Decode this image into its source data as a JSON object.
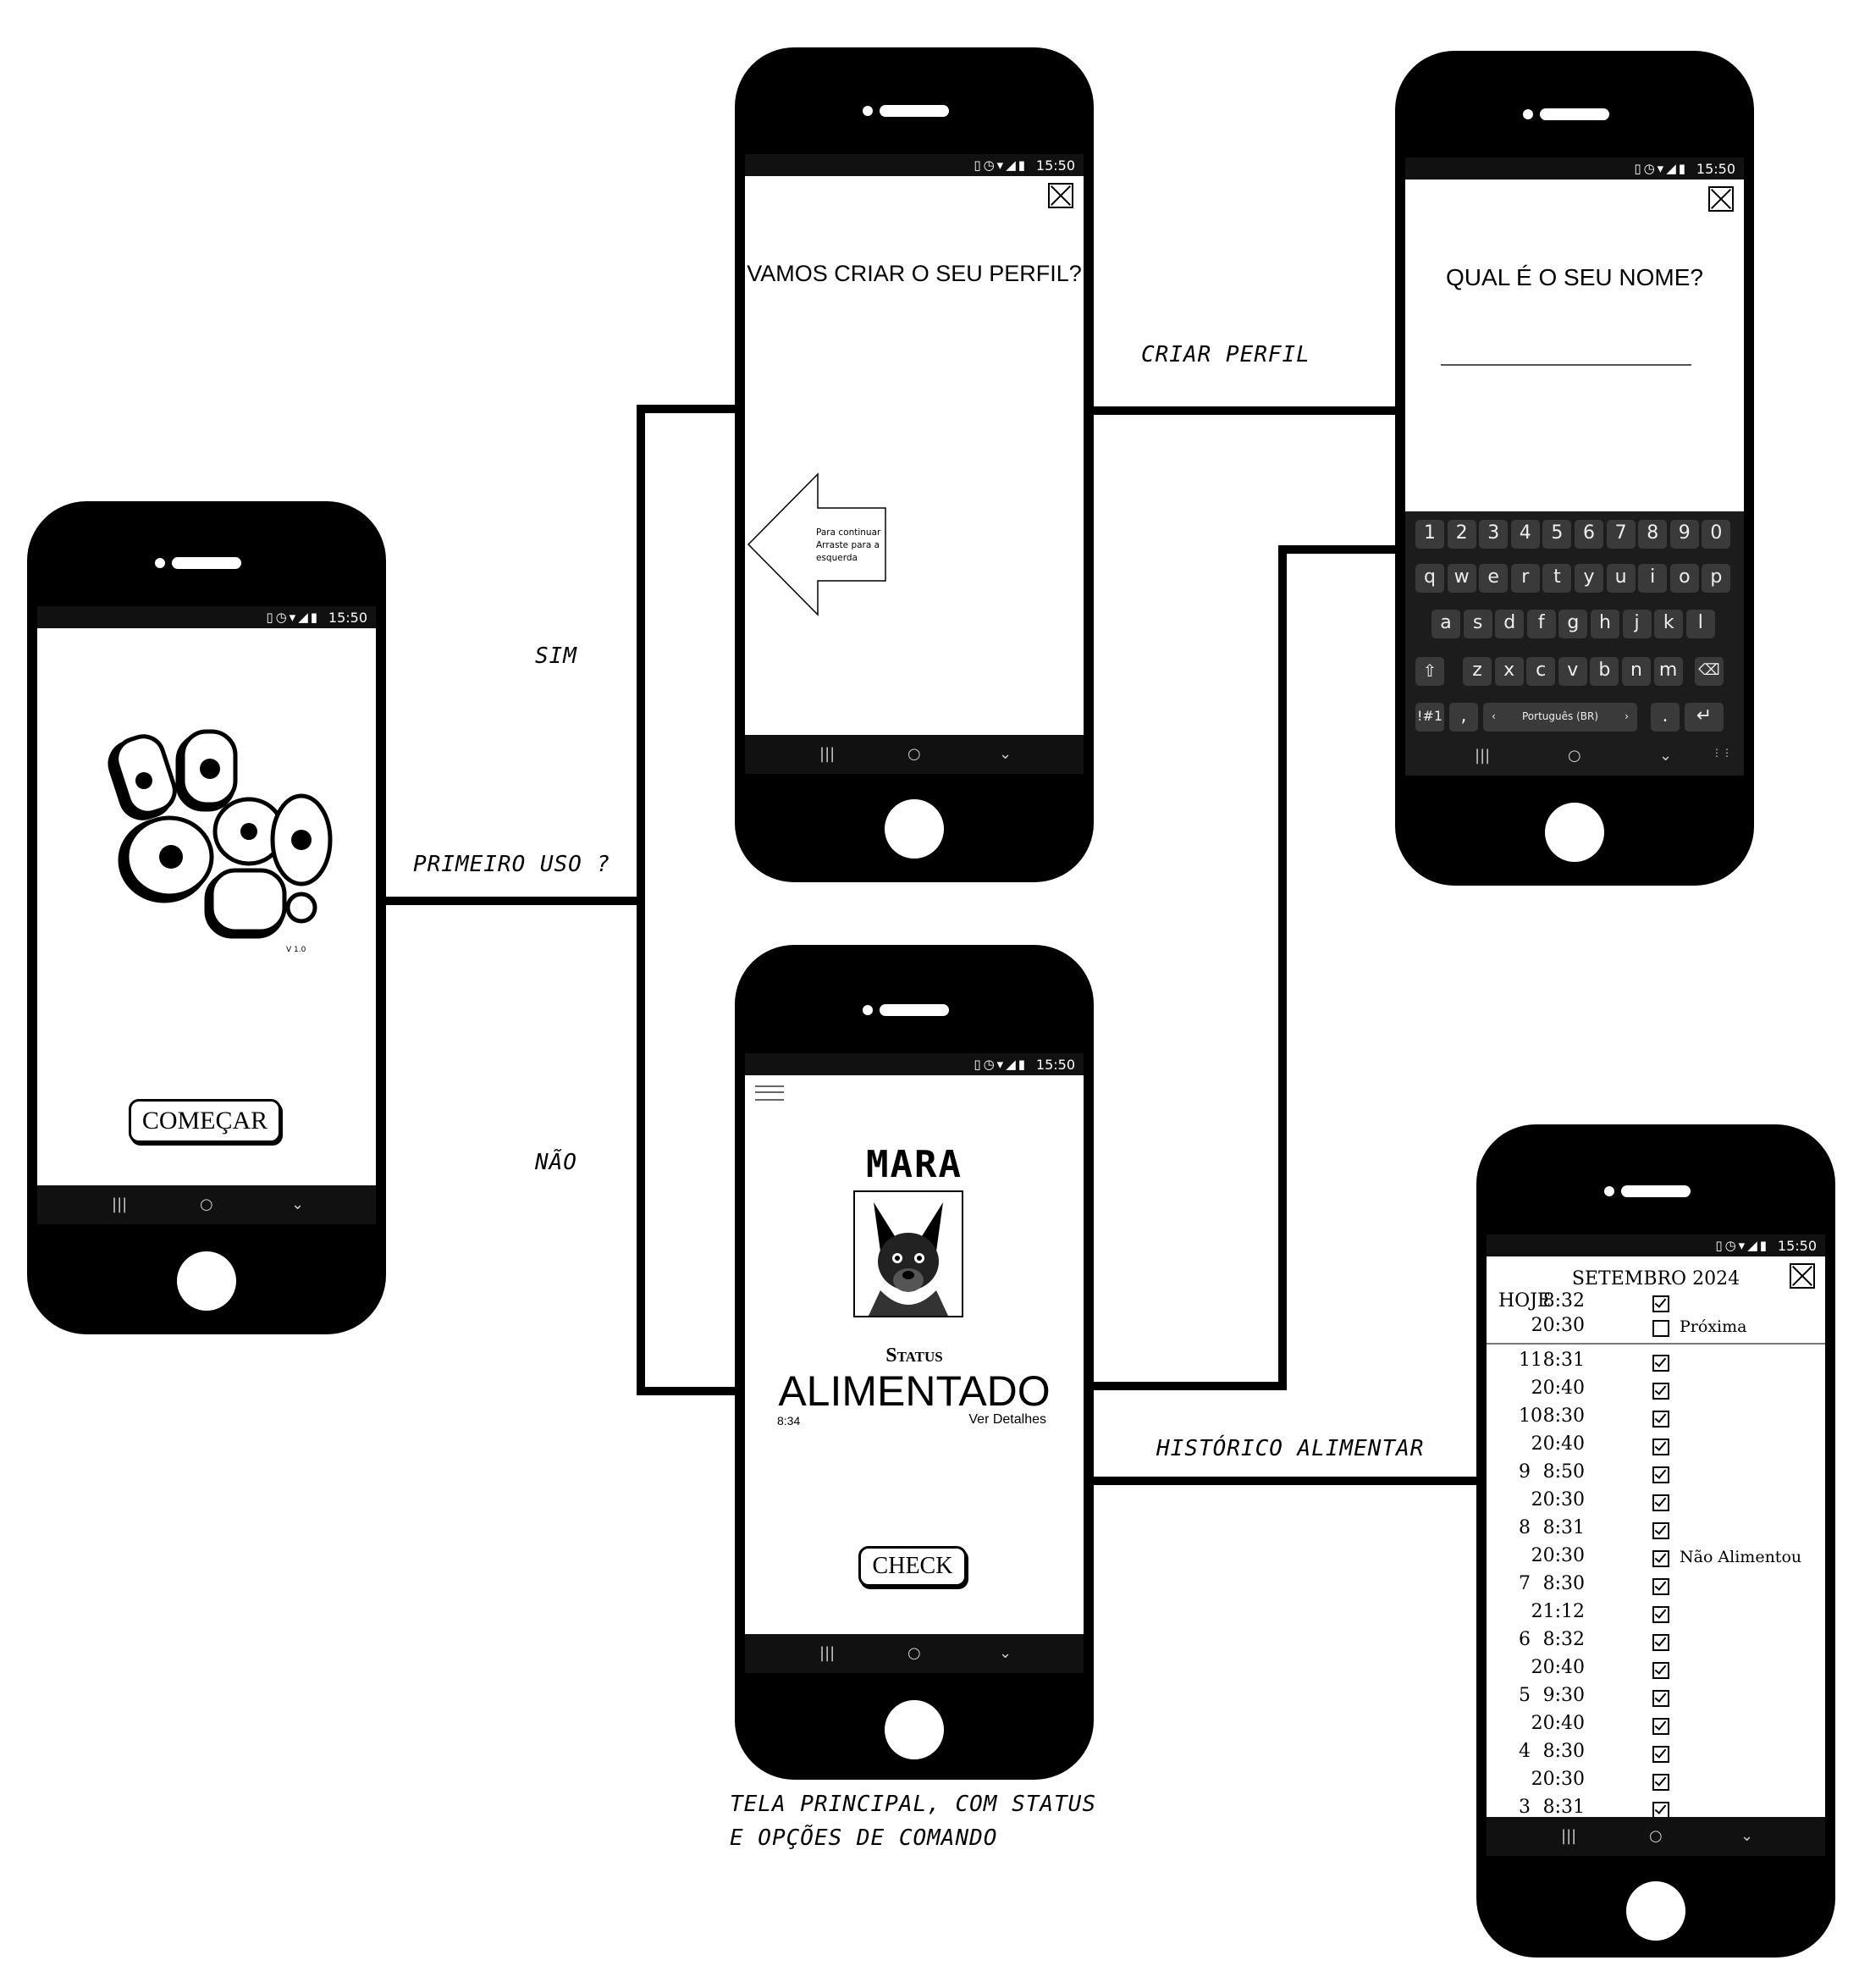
{
  "status_bar": {
    "time": "15:50"
  },
  "screens": {
    "splash": {
      "start_button": "COMEÇAR",
      "version": "V 1.0"
    },
    "profile_prompt": {
      "question": "VAMOS CRIAR O SEU PERFIL?",
      "hint": [
        "Para continuar",
        "Arraste para a",
        "esquerda"
      ]
    },
    "name_entry": {
      "question": "QUAL É O SEU NOME?",
      "keyboard": {
        "row_numbers": [
          "1",
          "2",
          "3",
          "4",
          "5",
          "6",
          "7",
          "8",
          "9",
          "0"
        ],
        "row_1": [
          "q",
          "w",
          "e",
          "r",
          "t",
          "y",
          "u",
          "i",
          "o",
          "p"
        ],
        "row_2": [
          "a",
          "s",
          "d",
          "f",
          "g",
          "h",
          "j",
          "k",
          "l"
        ],
        "row_3": [
          "z",
          "x",
          "c",
          "v",
          "b",
          "n",
          "m"
        ],
        "symbols_key": "!#1",
        "comma_key": ",",
        "language": "Português (BR)",
        "period_key": "."
      }
    },
    "main": {
      "pet_name": "MARA",
      "status_label": "Status",
      "status_value": "ALIMENTADO",
      "last_time": "8:34",
      "details_link": "Ver Detalhes",
      "check_button": "CHECK"
    },
    "history": {
      "month": "SETEMBRO 2024",
      "today_label": "HOJE",
      "today": [
        {
          "time": "8:32",
          "checked": true,
          "note": ""
        },
        {
          "time": "20:30",
          "checked": false,
          "note": "Próxima"
        }
      ],
      "rows": [
        {
          "day": "11",
          "time": "8:31",
          "note": ""
        },
        {
          "day": "",
          "time": "20:40",
          "note": ""
        },
        {
          "day": "10",
          "time": "8:30",
          "note": ""
        },
        {
          "day": "",
          "time": "20:40",
          "note": ""
        },
        {
          "day": "9",
          "time": "8:50",
          "note": ""
        },
        {
          "day": "",
          "time": "20:30",
          "note": ""
        },
        {
          "day": "8",
          "time": "8:31",
          "note": ""
        },
        {
          "day": "",
          "time": "20:30",
          "note": "Não Alimentou"
        },
        {
          "day": "7",
          "time": "8:30",
          "note": ""
        },
        {
          "day": "",
          "time": "21:12",
          "note": ""
        },
        {
          "day": "6",
          "time": "8:32",
          "note": ""
        },
        {
          "day": "",
          "time": "20:40",
          "note": ""
        },
        {
          "day": "5",
          "time": "9:30",
          "note": ""
        },
        {
          "day": "",
          "time": "20:40",
          "note": ""
        },
        {
          "day": "4",
          "time": "8:30",
          "note": ""
        },
        {
          "day": "",
          "time": "20:30",
          "note": ""
        },
        {
          "day": "3",
          "time": "8:31",
          "note": ""
        }
      ]
    }
  },
  "flow_labels": {
    "first_use": "PRIMEIRO USO ?",
    "yes": "SIM",
    "no": "NÃO",
    "create_profile": "CRIAR PERFIL",
    "feeding_history": "HISTÓRICO ALIMENTAR",
    "main_caption_1": "TELA PRINCIPAL, COM STATUS",
    "main_caption_2": "E OPÇÕES DE COMANDO"
  }
}
